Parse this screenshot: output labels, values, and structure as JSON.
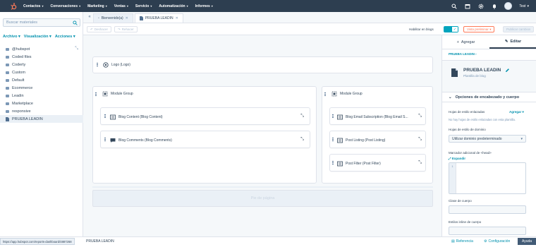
{
  "topnav": {
    "items": [
      "Contactos",
      "Conversaciones",
      "Marketing",
      "Ventas",
      "Servicio",
      "Automatización",
      "Informes"
    ],
    "user": "Test"
  },
  "sidebar": {
    "search_placeholder": "Buscar materiales",
    "menus": [
      "Archivo",
      "Visualización",
      "Acciones"
    ],
    "files": [
      "@hubspot",
      "Coded files",
      "Coderty",
      "Custom",
      "Default",
      "Ecommerce",
      "Leadin",
      "Marketplace",
      "responsive",
      "PRUEBA LEADIN"
    ]
  },
  "tabs": [
    {
      "label": "Bienvenido(a)",
      "active": false
    },
    {
      "label": "PRUEBA LEADIN",
      "active": true
    }
  ],
  "toolbar": {
    "undo": "Deshacer",
    "redo": "Rehacer",
    "toggle_label": "Habilitar en blogs",
    "preview": "Vista preliminar",
    "publish": "Publicar cambios"
  },
  "canvas": {
    "logo_module": "Logo (Logo)",
    "group_left": "Module Group",
    "group_right": "Module Group",
    "left_modules": [
      "Blog Content (Blog Content)",
      "Blog Comments (Blog Comments)"
    ],
    "right_modules": [
      "Blog Email Subscription (Blog Email S...",
      "Post Listing (Post Listing)",
      "Post Filter (Post Filter)"
    ],
    "footer": "Pie de página"
  },
  "rpanel": {
    "tab_add": "Agregar",
    "tab_edit": "Editar",
    "breadcrumb": "PRUEBA LEADIN",
    "title": "PRUEBA LEADIN",
    "subtitle": "Plantilla de blog",
    "section": "Opciones de encabezado y cuerpo",
    "stylesheets_label": "Hojas de estilo enlazadas",
    "stylesheets_add": "Agregar",
    "stylesheets_empty": "No hay hojas de estilo enlazadas con esta plantilla.",
    "domain_label": "Hojas de estilo de dominio",
    "domain_value": "Utilizar dominio predeterminado",
    "head_label": "Marcador adicional de <head>",
    "expand": "Expandir",
    "line_no": "1",
    "body_class_label": "Clase de cuerpo",
    "inline_label": "Estilos inline de cuerpo"
  },
  "statusbar": {
    "url": "https://app.hubspot.com/reports-dashboard/4887268",
    "name": "PRUEBA LEADIN",
    "reference": "Referencia",
    "config": "Configuración",
    "help": "Ayuda"
  }
}
